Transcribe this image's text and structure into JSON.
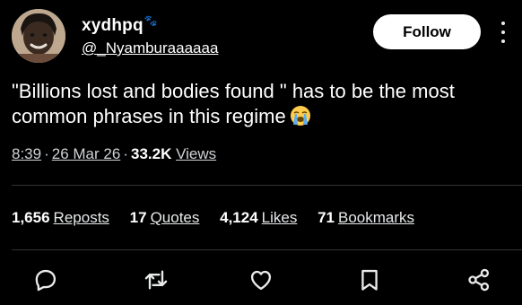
{
  "author": {
    "display_name": "xydhpq",
    "badge_icon": "paw-prints-icon",
    "handle": "@_Nyamburaaaaaa"
  },
  "follow_button": {
    "label": "Follow"
  },
  "tweet": {
    "text": "\"Billions lost and bodies found \" has to be the most common phrases in this regime",
    "emoji": "loudly-crying-face-icon"
  },
  "meta": {
    "time": "8:39",
    "date": "26 Mar 26",
    "views_count": "33.2K",
    "views_label": "Views"
  },
  "stats": {
    "reposts": {
      "count": "1,656",
      "label": "Reposts"
    },
    "quotes": {
      "count": "17",
      "label": "Quotes"
    },
    "likes": {
      "count": "4,124",
      "label": "Likes"
    },
    "bookmarks": {
      "count": "71",
      "label": "Bookmarks"
    }
  },
  "actions": [
    "reply-icon",
    "retweet-icon",
    "like-icon",
    "bookmark-icon",
    "share-icon"
  ],
  "colors": {
    "background": "#000000",
    "text": "#ffffff",
    "muted": "#cfd2d5",
    "divider": "#2f3336",
    "button_bg": "#ffffff"
  }
}
